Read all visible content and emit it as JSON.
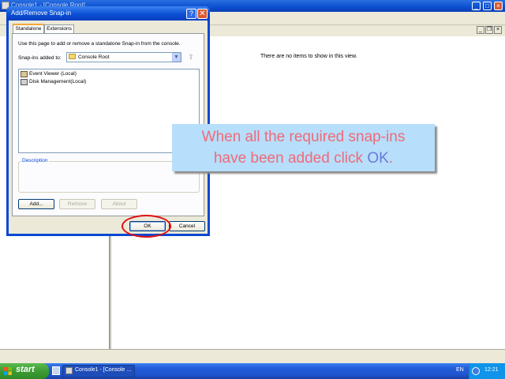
{
  "mmc": {
    "title": "Console1 - [Console Root]",
    "right_pane_empty_text": "There are no items to show in this view."
  },
  "dialog": {
    "title": "Add/Remove Snap-in",
    "help_label": "?",
    "close_label": "✕",
    "tabs": [
      {
        "label": "Standalone",
        "active": true
      },
      {
        "label": "Extensions",
        "active": false
      }
    ],
    "instruction": "Use this page to add or remove a standalone Snap-in from the console.",
    "snapins_added_to_label": "Snap-ins added to:",
    "snapins_added_to_value": "Console Root",
    "snapins": [
      {
        "label": "Event Viewer (Local)",
        "icon": "event-viewer-icon"
      },
      {
        "label": "Disk Management(Local)",
        "icon": "disk-management-icon"
      }
    ],
    "description_label": "Description",
    "buttons": {
      "add": "Add...",
      "remove": "Remove",
      "about": "About",
      "ok": "OK",
      "cancel": "Cancel"
    }
  },
  "callout": {
    "line1": "When all the required snap-ins",
    "line2_prefix": "have been added click ",
    "line2_highlight": "OK",
    "line2_suffix": ".",
    "text_color": "#f06a78",
    "highlight_color": "#6b7ad9",
    "background": "#b7defa"
  },
  "taskbar": {
    "start_label": "start",
    "task_label": "Console1 - [Console ...",
    "language": "EN",
    "clock": "12:21"
  }
}
